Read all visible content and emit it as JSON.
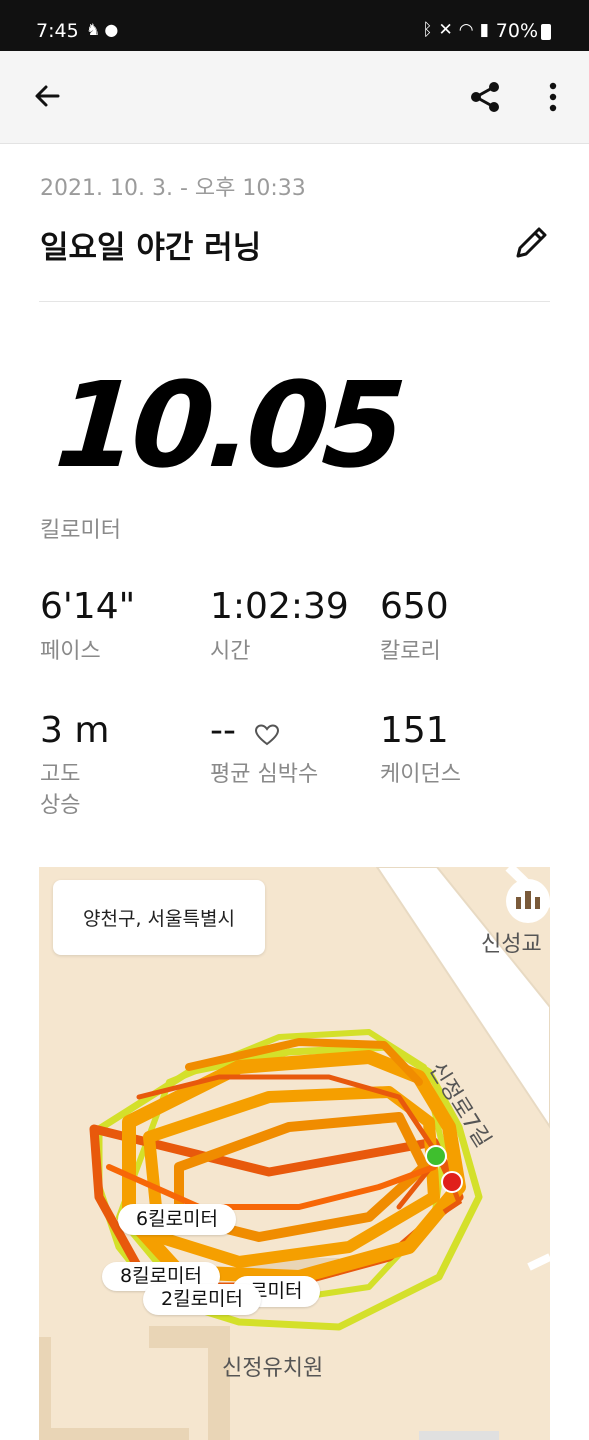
{
  "status_bar": {
    "time": "7:45",
    "battery": "70%",
    "left_icons": [
      "notification-icon",
      "chat-bubble-icon"
    ],
    "right_icons": [
      "bluetooth-icon",
      "mute-icon",
      "wifi-icon",
      "hd-voice-icon",
      "signal-icon",
      "battery-icon"
    ]
  },
  "app_bar": {
    "icons": [
      "back-arrow-icon",
      "share-icon",
      "more-vertical-icon"
    ]
  },
  "activity": {
    "date": "2021. 10. 3. - 오후 10:33",
    "title": "일요일 야간 러닝",
    "distance": "10.05",
    "distance_unit": "킬로미터"
  },
  "stats": [
    {
      "value": "6'14\"",
      "label": "페이스"
    },
    {
      "value": "1:02:39",
      "label": "시간"
    },
    {
      "value": "650",
      "label": "칼로리"
    },
    {
      "value": "3 m",
      "label_line1": "고도",
      "label_line2": "상승"
    },
    {
      "value": "--",
      "label": "평균 심박수"
    },
    {
      "value": "151",
      "label": "케이던스"
    }
  ],
  "map": {
    "location": "양천구, 서울특별시",
    "km_markers": [
      "6킬로미터",
      "8킬로미터",
      "로미터",
      "2킬로미터"
    ],
    "places": [
      "신성교",
      "신정로7길",
      "신정유치원"
    ],
    "route_colors": [
      "#e8590c",
      "#f59f00",
      "#d4e02a"
    ]
  }
}
